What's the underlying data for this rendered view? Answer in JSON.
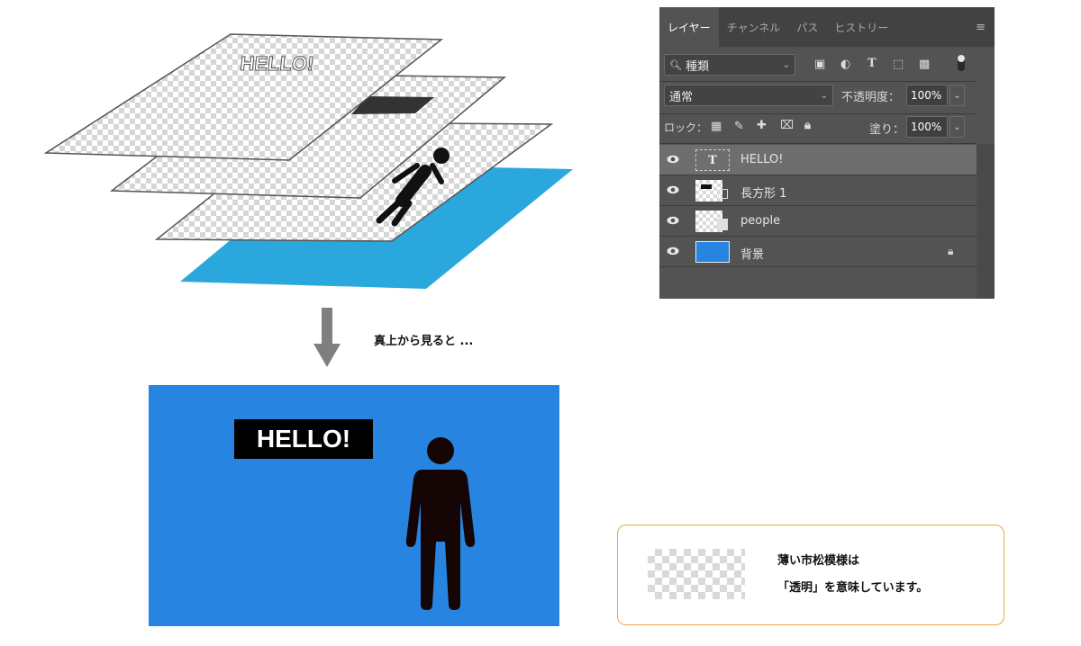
{
  "diagram": {
    "layer_text": "HELLO!"
  },
  "caption": "真上から見ると ...",
  "panel": {
    "tabs": [
      "レイヤー",
      "チャンネル",
      "パス",
      "ヒストリー"
    ],
    "menu_icon": "≡",
    "filter_label": "種類",
    "blend_mode": "通常",
    "opacity_label": "不透明度：",
    "opacity_value": "100%",
    "lock_label": "ロック：",
    "fill_label": "塗り：",
    "fill_value": "100%",
    "layers": [
      {
        "name": "HELLO!",
        "icon": "text-layer-icon",
        "selected": true
      },
      {
        "name": "長方形 1",
        "icon": "shape-layer-thumbnail"
      },
      {
        "name": "people",
        "icon": "people-layer-thumbnail"
      },
      {
        "name": "背景",
        "icon": "background-layer-thumbnail",
        "locked": true
      }
    ]
  },
  "result": {
    "hello_text": "HELLO!"
  },
  "note": {
    "line1": "薄い市松模様は",
    "line2": "「透明」を意味しています。"
  },
  "colors": {
    "background_layer_blue": "#2aa7dc",
    "result_blue": "#2784e0",
    "note_border": "#f0a63c",
    "panel_bg": "#535353"
  }
}
